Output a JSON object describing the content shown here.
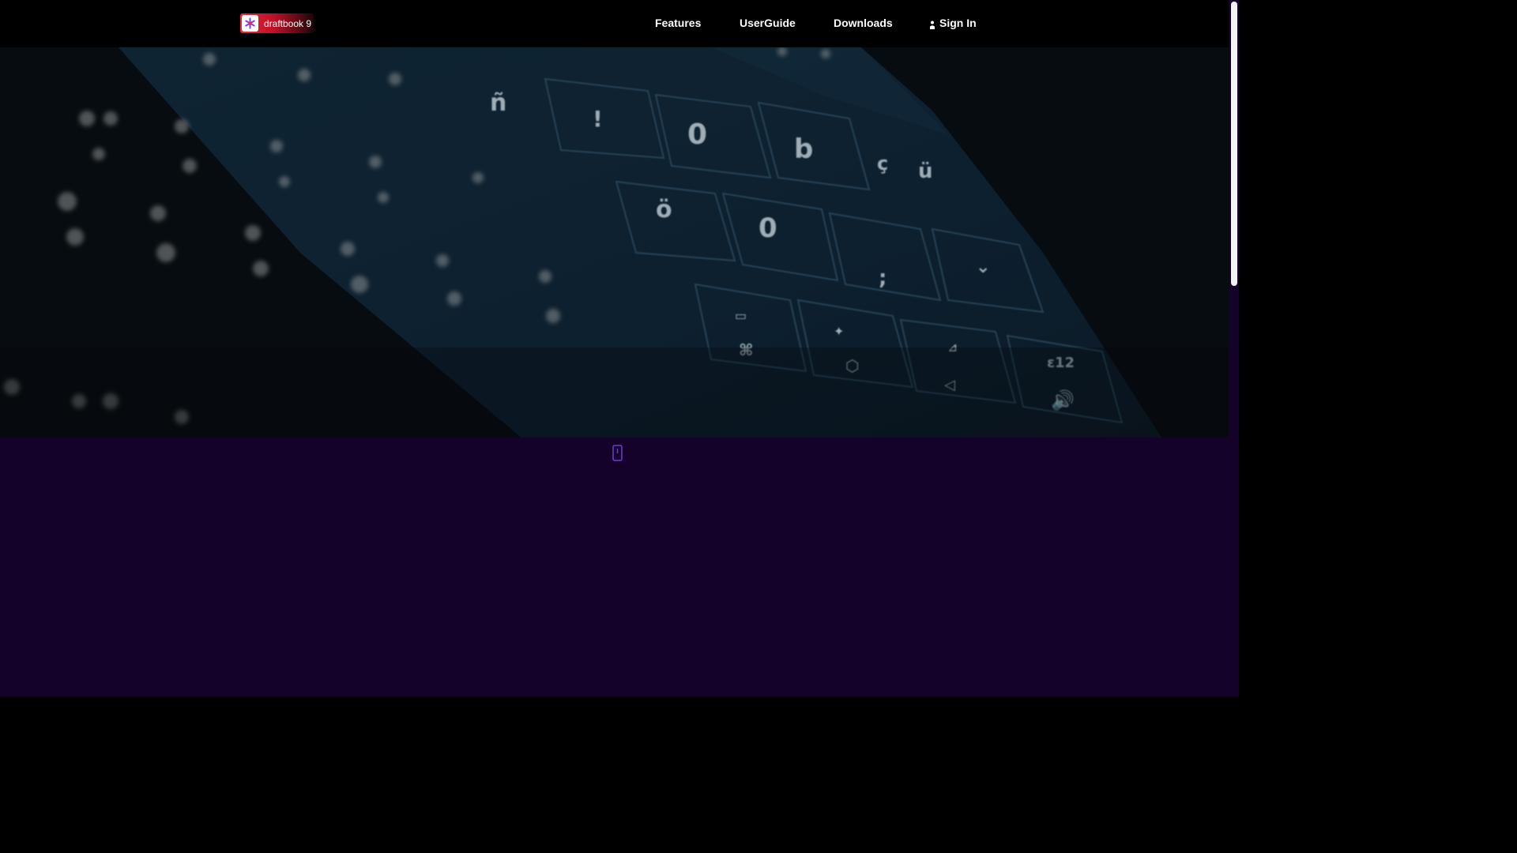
{
  "brand": {
    "name": "draftbook 9",
    "icon": "asterisk-logo-icon"
  },
  "nav": {
    "links": [
      {
        "label": "Features"
      },
      {
        "label": "UserGuide"
      },
      {
        "label": "Downloads"
      }
    ],
    "signin": {
      "label": "Sign In",
      "icon": "user-icon"
    }
  },
  "hero": {
    "image": "keyboard-background"
  },
  "scroll_indicator": {
    "icon": "scroll-down-icon"
  },
  "colors": {
    "navbar_bg": "#000000",
    "brand_red": "#e8283c",
    "section_bg": "#15022a",
    "section_glow": "#2a0a5a",
    "icon_purple": "#6b3fd0"
  }
}
